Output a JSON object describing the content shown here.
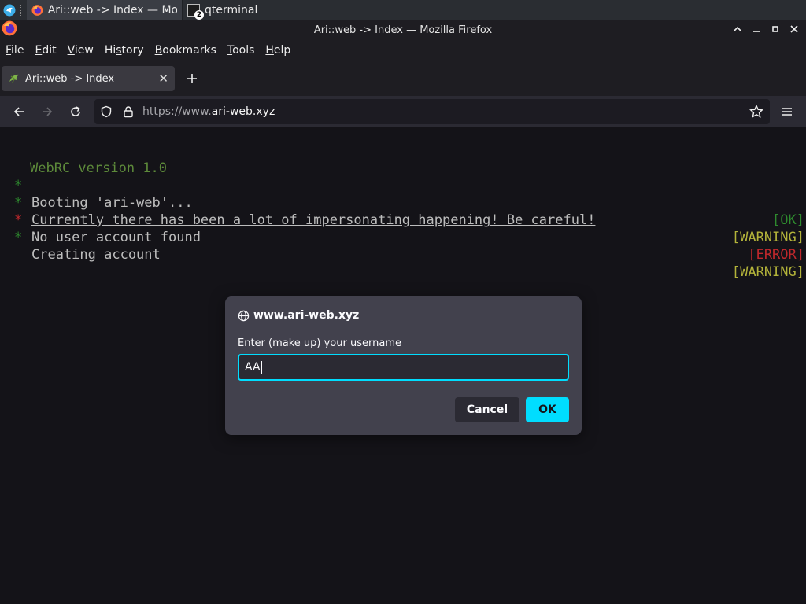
{
  "taskbar": {
    "tasks": [
      {
        "label": "Ari::web -> Index — Mo...",
        "active": true
      },
      {
        "label": "qterminal",
        "badge": "2",
        "active": false
      }
    ]
  },
  "window": {
    "title": "Ari::web -> Index — Mozilla Firefox",
    "controls": [
      "minimize",
      "restore",
      "maximize",
      "close"
    ]
  },
  "menubar": {
    "items": [
      {
        "label": "File",
        "accel": "F",
        "rest": "ile"
      },
      {
        "label": "Edit",
        "accel": "E",
        "rest": "dit"
      },
      {
        "label": "View",
        "accel": "V",
        "rest": "iew"
      },
      {
        "label": "History",
        "pre": "Hi",
        "accel": "s",
        "rest": "tory"
      },
      {
        "label": "Bookmarks",
        "accel": "B",
        "rest": "ookmarks"
      },
      {
        "label": "Tools",
        "accel": "T",
        "rest": "ools"
      },
      {
        "label": "Help",
        "accel": "H",
        "rest": "elp"
      }
    ]
  },
  "tabs": [
    {
      "label": "Ari::web -> Index",
      "active": true
    }
  ],
  "navbar": {
    "url_prefix": "https://www.",
    "url_domain": "ari-web.xyz"
  },
  "console": {
    "header": "WebRC version 1.0",
    "lines": [
      {
        "bullet": "*",
        "text": "Booting 'ari-web'...",
        "status": "[OK]",
        "status_color": "#2e8a2e",
        "bullet_color": "#2e8a2e",
        "underline": false
      },
      {
        "bullet": "*",
        "text": "Currently there has been a lot of impersonating happening! Be careful!",
        "status": "[WARNING]",
        "status_color": "#b3b33a",
        "bullet_color": "#2e8a2e",
        "underline": true
      },
      {
        "bullet": "*",
        "text": "No user account found",
        "status": "[ERROR]",
        "status_color": "#c0282c",
        "bullet_color": "#c0282c",
        "underline": false
      },
      {
        "bullet": "*",
        "text": "Creating account",
        "status": "[WARNING]",
        "status_color": "#b3b33a",
        "bullet_color": "#2e8a2e",
        "underline": false
      }
    ],
    "header_color": "#5d8a3a"
  },
  "dialog": {
    "origin": "www.ari-web.xyz",
    "prompt": "Enter (make up) your username",
    "input_value": "AA",
    "cancel_label": "Cancel",
    "ok_label": "OK"
  },
  "colors": {
    "accent": "#00ddff",
    "background": "#141318"
  }
}
